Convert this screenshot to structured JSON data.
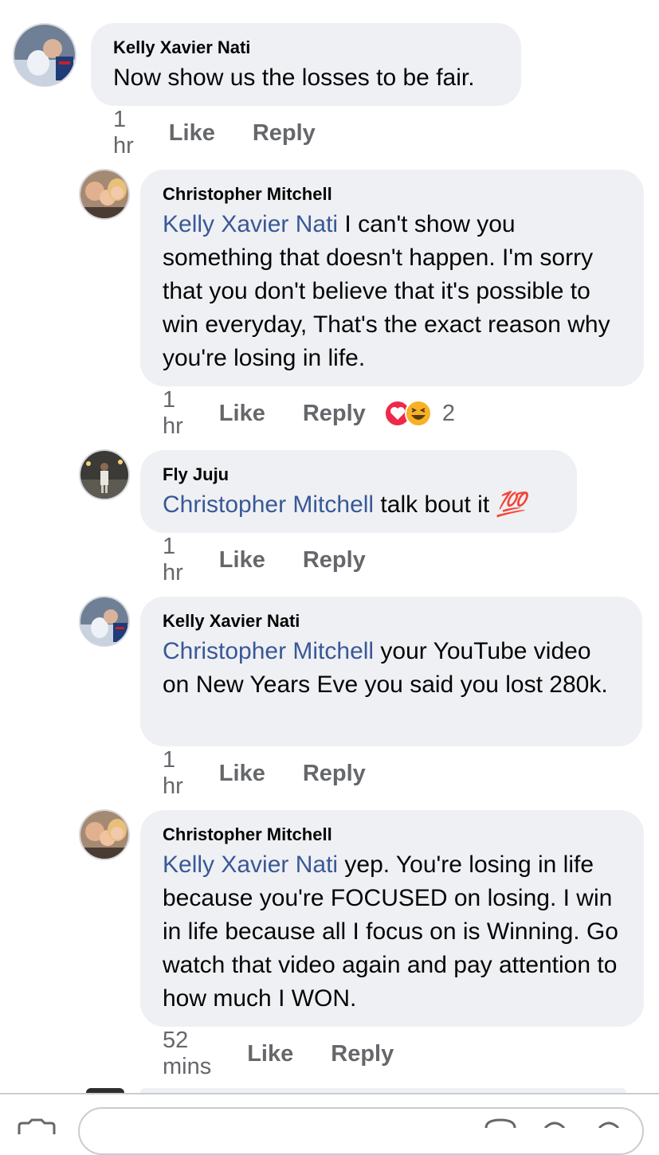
{
  "comments": [
    {
      "author": "Kelly Xavier Nati",
      "mention": "",
      "text": "Now show us the losses to be fair.",
      "time": "1 hr",
      "like": "Like",
      "reply": "Reply",
      "reaction_count": ""
    },
    {
      "author": "Christopher Mitchell",
      "mention": "Kelly Xavier Nati",
      "text": " I can't show you something that doesn't happen. I'm sorry that you don't believe that it's possible to win everyday, That's the exact reason why you're losing in life.",
      "time": "1 hr",
      "like": "Like",
      "reply": "Reply",
      "reaction_count": "2",
      "reaction_icons": [
        "love-reaction-icon",
        "haha-reaction-icon"
      ]
    },
    {
      "author": "Fly Juju",
      "mention": "Christopher Mitchell",
      "text": " talk bout it ",
      "emoji": "💯",
      "time": "1 hr",
      "like": "Like",
      "reply": "Reply",
      "reaction_count": ""
    },
    {
      "author": "Kelly Xavier Nati",
      "mention": "Christopher Mitchell",
      "text": " your YouTube video on New Years Eve you said you lost 280k.",
      "time": "1 hr",
      "like": "Like",
      "reply": "Reply",
      "reaction_count": ""
    },
    {
      "author": "Christopher Mitchell",
      "mention": "Kelly Xavier Nati",
      "text": " yep. You're losing in life because you're FOCUSED on losing. I win in life because all I focus on is Winning. Go watch that video again and pay attention to how much I WON.",
      "time": "52 mins",
      "like": "Like",
      "reply": "Reply",
      "reaction_count": ""
    }
  ],
  "colors": {
    "mention": "#385898",
    "bubble": "#eff0f3",
    "meta": "#65676b",
    "love": "#f0284a",
    "haha": "#f7b125"
  }
}
